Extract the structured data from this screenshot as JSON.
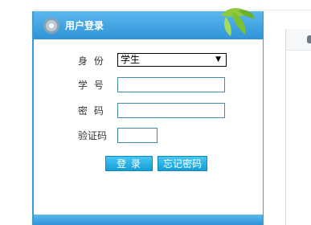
{
  "login_panel": {
    "title": "用户登录",
    "identity_label": "身  份",
    "identity_selected": "学生",
    "student_id_label": "学  号",
    "password_label": "密  码",
    "captcha_label": "验证码",
    "login_button": "登 录",
    "forgot_button": "忘记密码"
  },
  "colors": {
    "header_blue": "#3b9ad8",
    "button_blue": "#139fd8",
    "input_border": "#3d8dab"
  },
  "icons": {
    "header_icon": "gear-icon",
    "decoration": "leaves-decoration",
    "select_arrow": "chevron-down-icon"
  }
}
